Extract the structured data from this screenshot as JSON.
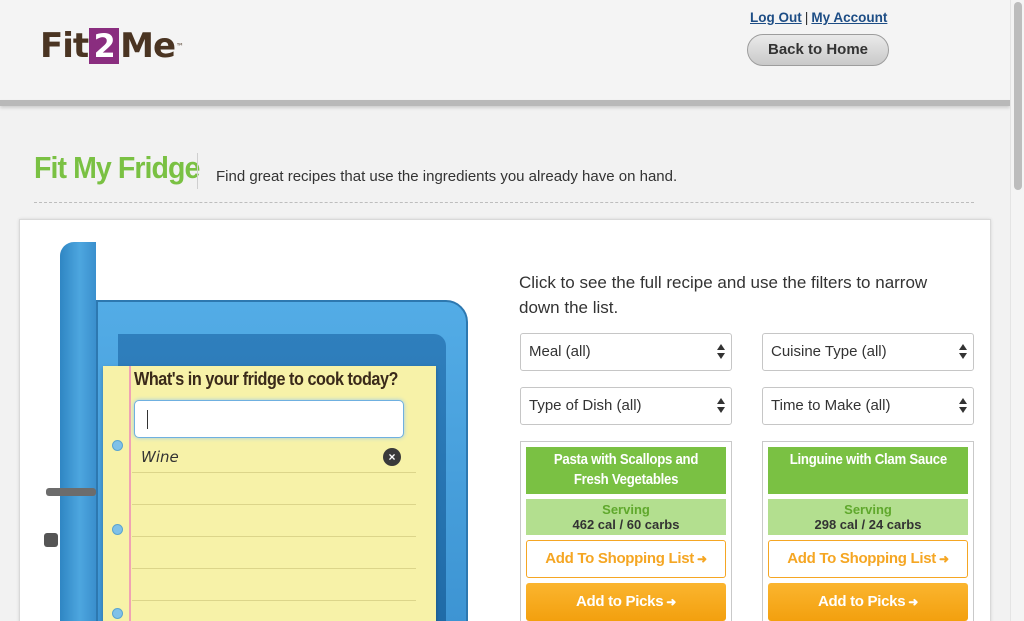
{
  "header": {
    "logo": {
      "part1": "Fit",
      "part2": "2",
      "part3": "Me",
      "tm": "™"
    },
    "logout_label": "Log Out",
    "separator": "|",
    "account_label": "My Account",
    "home_button": "Back to Home"
  },
  "page": {
    "title": "Fit My Fridge",
    "description": "Find great recipes that use the ingredients you already have on hand."
  },
  "fridge": {
    "prompt": "What's in your fridge to cook today?",
    "input_value": "",
    "ingredients": [
      "Wine"
    ],
    "remove_icon": "×"
  },
  "results": {
    "instructions": "Click to see the full recipe and use the filters to narrow down the list.",
    "filters": {
      "meal": "Meal (all)",
      "cuisine": "Cuisine Type (all)",
      "dish": "Type of Dish (all)",
      "time": "Time to Make (all)"
    },
    "recipes": [
      {
        "title": "Pasta with Scallops and Fresh Vegetables",
        "serving_label": "Serving",
        "serving_value": "462 cal / 60 carbs",
        "shop_label": "Add To Shopping List",
        "picks_label": "Add to Picks"
      },
      {
        "title": "Linguine with Clam Sauce",
        "serving_label": "Serving",
        "serving_value": "298 cal / 24 carbs",
        "shop_label": "Add To Shopping List",
        "picks_label": "Add to Picks"
      }
    ]
  },
  "colors": {
    "brand_green": "#7ac143",
    "brand_purple": "#8a2d7f",
    "accent_orange": "#f5a623",
    "link_blue": "#1d4d85"
  }
}
